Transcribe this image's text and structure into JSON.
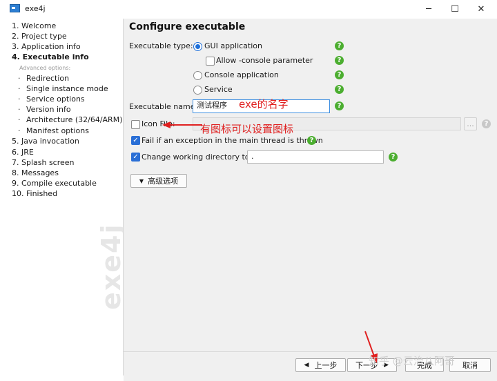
{
  "window": {
    "title": "exe4j"
  },
  "sidebar": {
    "steps": [
      {
        "label": "1. Welcome"
      },
      {
        "label": "2. Project type"
      },
      {
        "label": "3. Application info"
      },
      {
        "label": "4. Executable info"
      },
      {
        "label": "5. Java invocation"
      },
      {
        "label": "6. JRE"
      },
      {
        "label": "7. Splash screen"
      },
      {
        "label": "8. Messages"
      },
      {
        "label": "9. Compile executable"
      },
      {
        "label": "10. Finished"
      }
    ],
    "advanced_caption": "Advanced options:",
    "substeps": [
      {
        "label": "Redirection"
      },
      {
        "label": "Single instance mode"
      },
      {
        "label": "Service options"
      },
      {
        "label": "Version info"
      },
      {
        "label": "Architecture (32/64/ARM)"
      },
      {
        "label": "Manifest options"
      }
    ],
    "watermark": "exe4j"
  },
  "main": {
    "title": "Configure executable",
    "executable_type_label": "Executable type:",
    "options": {
      "gui": "GUI application",
      "allow_console": "Allow -console parameter",
      "console": "Console application",
      "service": "Service"
    },
    "executable_name_label": "Executable name:",
    "executable_name_value": "测试程序",
    "icon_file_label": "Icon File:",
    "fail_label": "Fail if an exception in the main thread is thrown",
    "change_dir_label": "Change working directory to:",
    "change_dir_value": ".",
    "advanced_button": "高级选项",
    "browse_button": "..."
  },
  "footer": {
    "back": "上一步",
    "next": "下一步",
    "finish": "完成",
    "cancel": "取消"
  },
  "annotations": {
    "exe_name": "exe的名字",
    "icon": "有图标可以设置图标"
  },
  "source_watermark": "知乎 @云治八阿哥",
  "colors": {
    "accent": "#1e6fd9",
    "help": "#4cae30",
    "annotation": "#e02020"
  }
}
